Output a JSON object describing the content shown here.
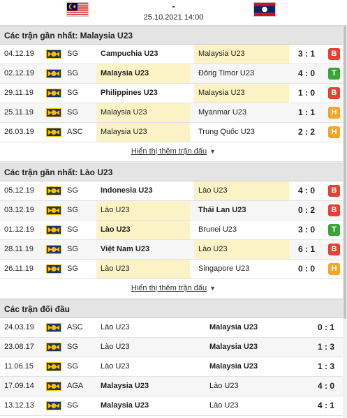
{
  "header": {
    "score": "-",
    "date_time": "25.10.2021 14:00"
  },
  "sections": {
    "malaysia": {
      "title": "Các trận gần nhất: Malaysia U23",
      "more_label": "Hiển thị thêm trận đấu",
      "rows": [
        {
          "date": "04.12.19",
          "comp": "SG",
          "home": "Campuchia U23",
          "away": "Malaysia U23",
          "score": "3 : 1",
          "result": "B"
        },
        {
          "date": "02.12.19",
          "comp": "SG",
          "home": "Malaysia U23",
          "away": "Đông Timor U23",
          "score": "4 : 0",
          "result": "T"
        },
        {
          "date": "29.11.19",
          "comp": "SG",
          "home": "Philippines U23",
          "away": "Malaysia U23",
          "score": "1 : 0",
          "result": "B"
        },
        {
          "date": "25.11.19",
          "comp": "SG",
          "home": "Malaysia U23",
          "away": "Myanmar U23",
          "score": "1 : 1",
          "result": "H"
        },
        {
          "date": "26.03.19",
          "comp": "ASC",
          "home": "Malaysia U23",
          "away": "Trung Quốc U23",
          "score": "2 : 2",
          "result": "H"
        }
      ]
    },
    "laos": {
      "title": "Các trận gần nhất: Lào U23",
      "more_label": "Hiển thị thêm trận đấu",
      "rows": [
        {
          "date": "05.12.19",
          "comp": "SG",
          "home": "Indonesia U23",
          "away": "Lào U23",
          "score": "4 : 0",
          "result": "B"
        },
        {
          "date": "03.12.19",
          "comp": "SG",
          "home": "Lào U23",
          "away": "Thái Lan U23",
          "score": "0 : 2",
          "result": "B"
        },
        {
          "date": "01.12.19",
          "comp": "SG",
          "home": "Lào U23",
          "away": "Brunei U23",
          "score": "3 : 0",
          "result": "T"
        },
        {
          "date": "28.11.19",
          "comp": "SG",
          "home": "Việt Nam U23",
          "away": "Lào U23",
          "score": "6 : 1",
          "result": "B"
        },
        {
          "date": "26.11.19",
          "comp": "SG",
          "home": "Lào U23",
          "away": "Singapore U23",
          "score": "0 : 0",
          "result": "H"
        }
      ]
    },
    "h2h": {
      "title": "Các trận đối đầu",
      "rows": [
        {
          "date": "24.03.19",
          "comp": "ASC",
          "home": "Lào U23",
          "away": "Malaysia U23",
          "score": "0 : 1"
        },
        {
          "date": "23.08.17",
          "comp": "SG",
          "home": "Lào U23",
          "away": "Malaysia U23",
          "score": "1 : 3"
        },
        {
          "date": "11.06.15",
          "comp": "SG",
          "home": "Lào U23",
          "away": "Malaysia U23",
          "score": "1 : 3"
        },
        {
          "date": "17.09.14",
          "comp": "AGA",
          "home": "Malaysia U23",
          "away": "Lào U23",
          "score": "4 : 0"
        },
        {
          "date": "13.12.13",
          "comp": "SG",
          "home": "Malaysia U23",
          "away": "Lào U23",
          "score": "4 : 1"
        }
      ]
    }
  },
  "colors": {
    "result_loss": "#e8402f",
    "result_win": "#3aa537",
    "result_draw": "#f5a623",
    "highlight": "#fbf3c6",
    "section_bg": "#e4e4e4"
  },
  "icons": {
    "home_flag": "malaysia-flag-icon",
    "away_flag": "laos-flag-icon",
    "competition": "competition-icon",
    "more_caret": "caret-down-icon"
  }
}
